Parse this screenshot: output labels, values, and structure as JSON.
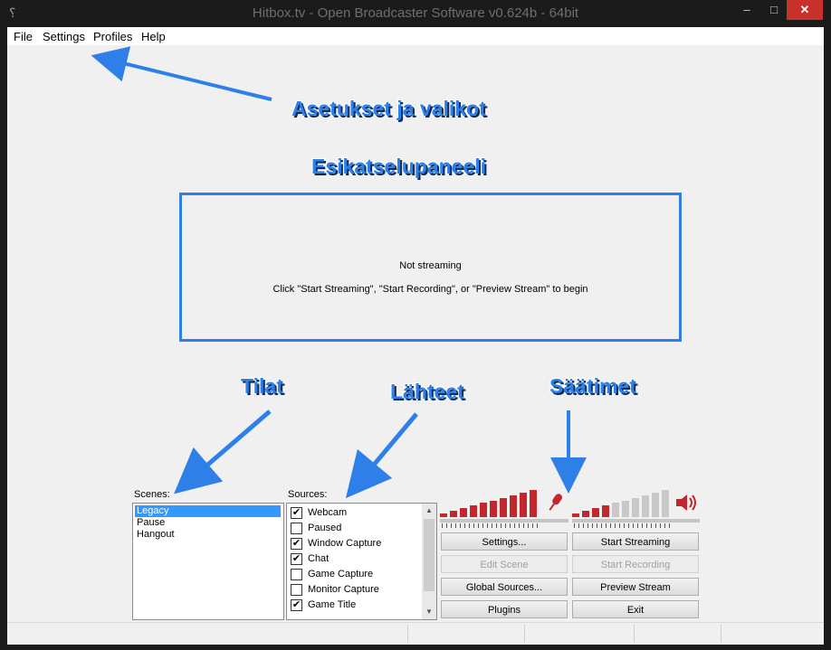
{
  "window": {
    "title": "Hitbox.tv - Open Broadcaster Software v0.624b - 64bit"
  },
  "menu": [
    "File",
    "Settings",
    "Profiles",
    "Help"
  ],
  "annotations": {
    "menu": "Asetukset ja valikot",
    "preview": "Esikatselupaneeli",
    "scenes": "Tilat",
    "sources": "Lähteet",
    "controls": "Säätimet"
  },
  "preview": {
    "status": "Not streaming",
    "hint": "Click \"Start Streaming\", \"Start Recording\", or \"Preview Stream\" to begin"
  },
  "scenes": {
    "label": "Scenes:",
    "items": [
      "Legacy",
      "Pause",
      "Hangout"
    ],
    "selected": "Legacy"
  },
  "sources": {
    "label": "Sources:",
    "items": [
      {
        "name": "Webcam",
        "checked": true
      },
      {
        "name": "Paused",
        "checked": false
      },
      {
        "name": "Window Capture",
        "checked": true
      },
      {
        "name": "Chat",
        "checked": true
      },
      {
        "name": "Game Capture",
        "checked": false
      },
      {
        "name": "Monitor Capture",
        "checked": false
      },
      {
        "name": "Game Title",
        "checked": true
      }
    ]
  },
  "audio": {
    "mic_icon": "microphone-icon",
    "speaker_icon": "speaker-icon",
    "mic_color": "#c1272d",
    "speaker_color": "#c1272d",
    "active_bar_color": "#c1272d",
    "inactive_bar_color": "#c8c8c8"
  },
  "buttons": {
    "settings": "Settings...",
    "start_streaming": "Start Streaming",
    "edit_scene": "Edit Scene",
    "start_recording": "Start Recording",
    "global_sources": "Global Sources...",
    "preview_stream": "Preview Stream",
    "plugins": "Plugins",
    "exit": "Exit"
  },
  "accent_color": "#2f7fe8"
}
